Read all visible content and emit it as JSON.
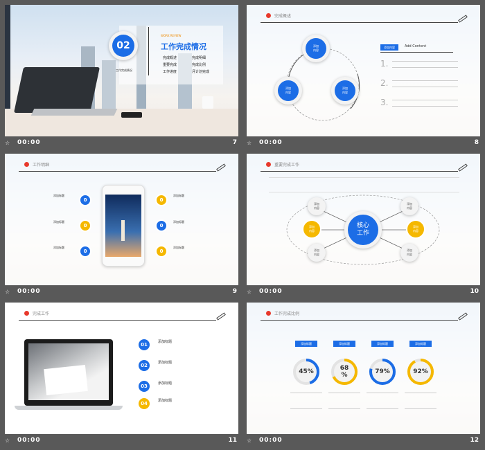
{
  "footer_time": "00:00",
  "slides": [
    {
      "number": "7",
      "badge": "02",
      "eyebrow": "WORK REVIEW",
      "title": "工作完成情况",
      "subtitle": "工作完成情况",
      "items": [
        "完成概述",
        "完成明细",
        "重要完成",
        "完成比例",
        "工作进度",
        "月计划完成"
      ]
    },
    {
      "number": "8",
      "header": "完成概述",
      "circle_label": "添加\n内容",
      "tag": "添加内容",
      "tag_en": "Add Content",
      "steps": [
        "1.",
        "2.",
        "3."
      ]
    },
    {
      "number": "9",
      "header": "工作明细",
      "item_title": "添加标题",
      "item_numbers": [
        "0",
        "0",
        "0",
        "0",
        "0",
        "0"
      ]
    },
    {
      "number": "10",
      "header": "重要完成工作",
      "center_label": "核心\n工作",
      "node_label": "添加\n内容"
    },
    {
      "number": "11",
      "header": "完成工作",
      "item_title": "添加标题",
      "item_numbers": [
        "01",
        "02",
        "03",
        "04"
      ]
    },
    {
      "number": "12",
      "header": "工作完成比例",
      "tag": "添加标题",
      "percents": [
        "45%",
        "68\n%",
        "79%",
        "92%"
      ],
      "percent_values": [
        45,
        68,
        79,
        92
      ]
    }
  ]
}
